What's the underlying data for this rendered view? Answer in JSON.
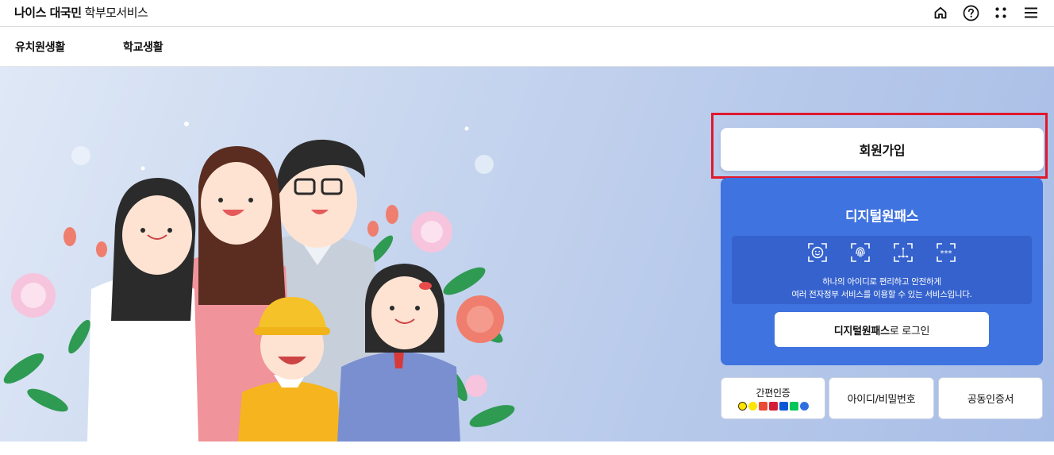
{
  "header": {
    "brand_bold": "나이스 대국민",
    "brand_rest": "학부모서비스",
    "icons": [
      "home-icon",
      "help-icon",
      "apps-grid-icon",
      "menu-icon"
    ]
  },
  "nav": {
    "items": [
      "유치원생활",
      "학교생활"
    ]
  },
  "hero": {
    "join_label": "회원가입",
    "digital_pass": {
      "title": "디지털원패스",
      "icons": [
        "face-recognition-icon",
        "fingerprint-icon",
        "pattern-icon",
        "pin-password-icon"
      ],
      "desc_line1": "하나의 아이디로 편리하고 안전하게",
      "desc_line2": "여러 전자정부 서비스를 이용할 수 있는 서비스입니다.",
      "login_bold": "디지털원패스",
      "login_rest": "로 로그인"
    },
    "auth": {
      "simple_label": "간편인증",
      "simple_logo_colors": [
        "#3b2e00",
        "#fee500",
        "#e94b36",
        "#d3203a",
        "#0a58d6",
        "#03c75a",
        "#2f6fe0"
      ],
      "id_password_label": "아이디/비밀번호",
      "certificate_label": "공동인증서"
    }
  },
  "colors": {
    "highlight_frame": "#e0182d",
    "digital_pass_bg": "#3f73e0",
    "hero_bg": "#c9d7ef"
  }
}
